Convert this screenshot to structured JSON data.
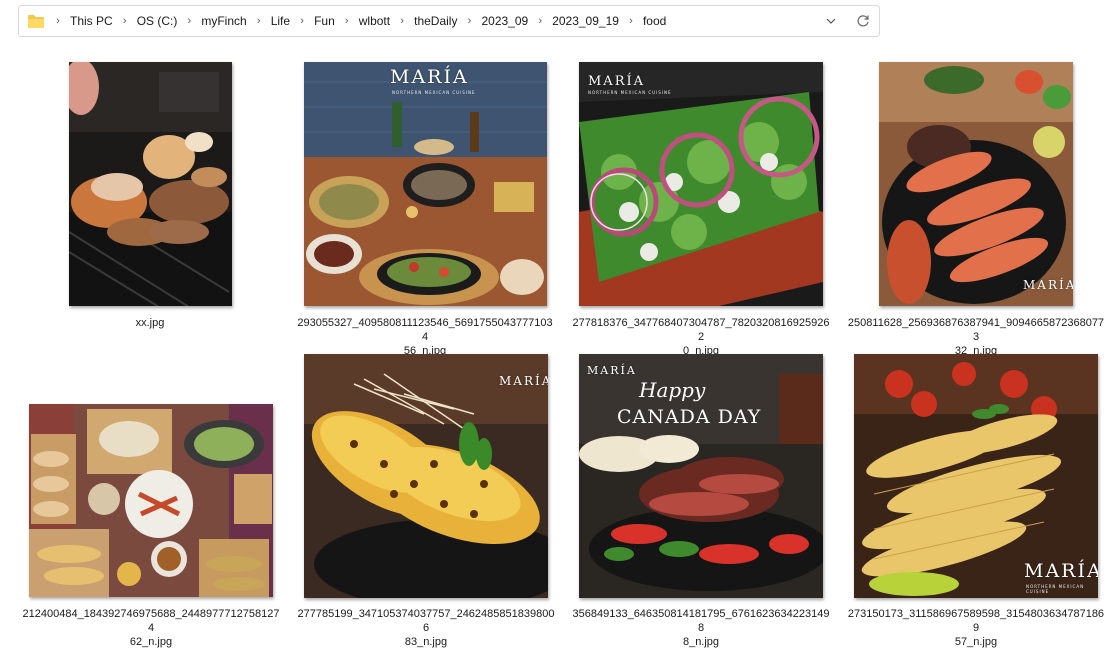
{
  "address_bar": {
    "path": [
      "This PC",
      "OS (C:)",
      "myFinch",
      "Life",
      "Fun",
      "wlbott",
      "theDaily",
      "2023_09",
      "2023_09_19",
      "food"
    ]
  },
  "files": [
    {
      "name": "xx.jpg"
    },
    {
      "name": "293055327_409580811123546_5691755043777103456_n.jpg"
    },
    {
      "name": "277818376_347768407304787_7820320816925926 20_n.jpg"
    },
    {
      "name": "250811628_256936876387941_9094665872368077332_n.jpg"
    },
    {
      "name": "212400484_184392746975688_2448977712758127462_n.jpg"
    },
    {
      "name": "277785199_347105374037757_2462485851839800683_n.jpg"
    },
    {
      "name": "356849133_646350814181795_6761623634223149 88_n.jpg"
    },
    {
      "name": "273150173_311586967589598_3154803634787186957_n.jpg"
    }
  ],
  "captions": [
    [
      "xx.jpg"
    ],
    [
      "293055327_409580811123546_56917550437771034",
      "56_n.jpg"
    ],
    [
      "277818376_347768407304787_78203208169259262",
      "0_n.jpg"
    ],
    [
      "250811628_256936876387941_90946658723680773",
      "32_n.jpg"
    ],
    [
      "212400484_184392746975688_24489777127581274",
      "62_n.jpg"
    ],
    [
      "277785199_347105374037757_24624858518398006",
      "83_n.jpg"
    ],
    [
      "356849133_646350814181795_67616236342231498",
      "8_n.jpg"
    ],
    [
      "273150173_311586967589598_31548036347871869",
      "57_n.jpg"
    ]
  ],
  "overlays": {
    "brand": "MARÍA",
    "brand_sub": "NORTHERN MEXICAN CUISINE",
    "happy": "Happy",
    "canada_day": "CANADA DAY"
  },
  "colors": {
    "folder": "#f2c94c",
    "hover": "#e5f3ff",
    "border": "#d9d9d9"
  }
}
